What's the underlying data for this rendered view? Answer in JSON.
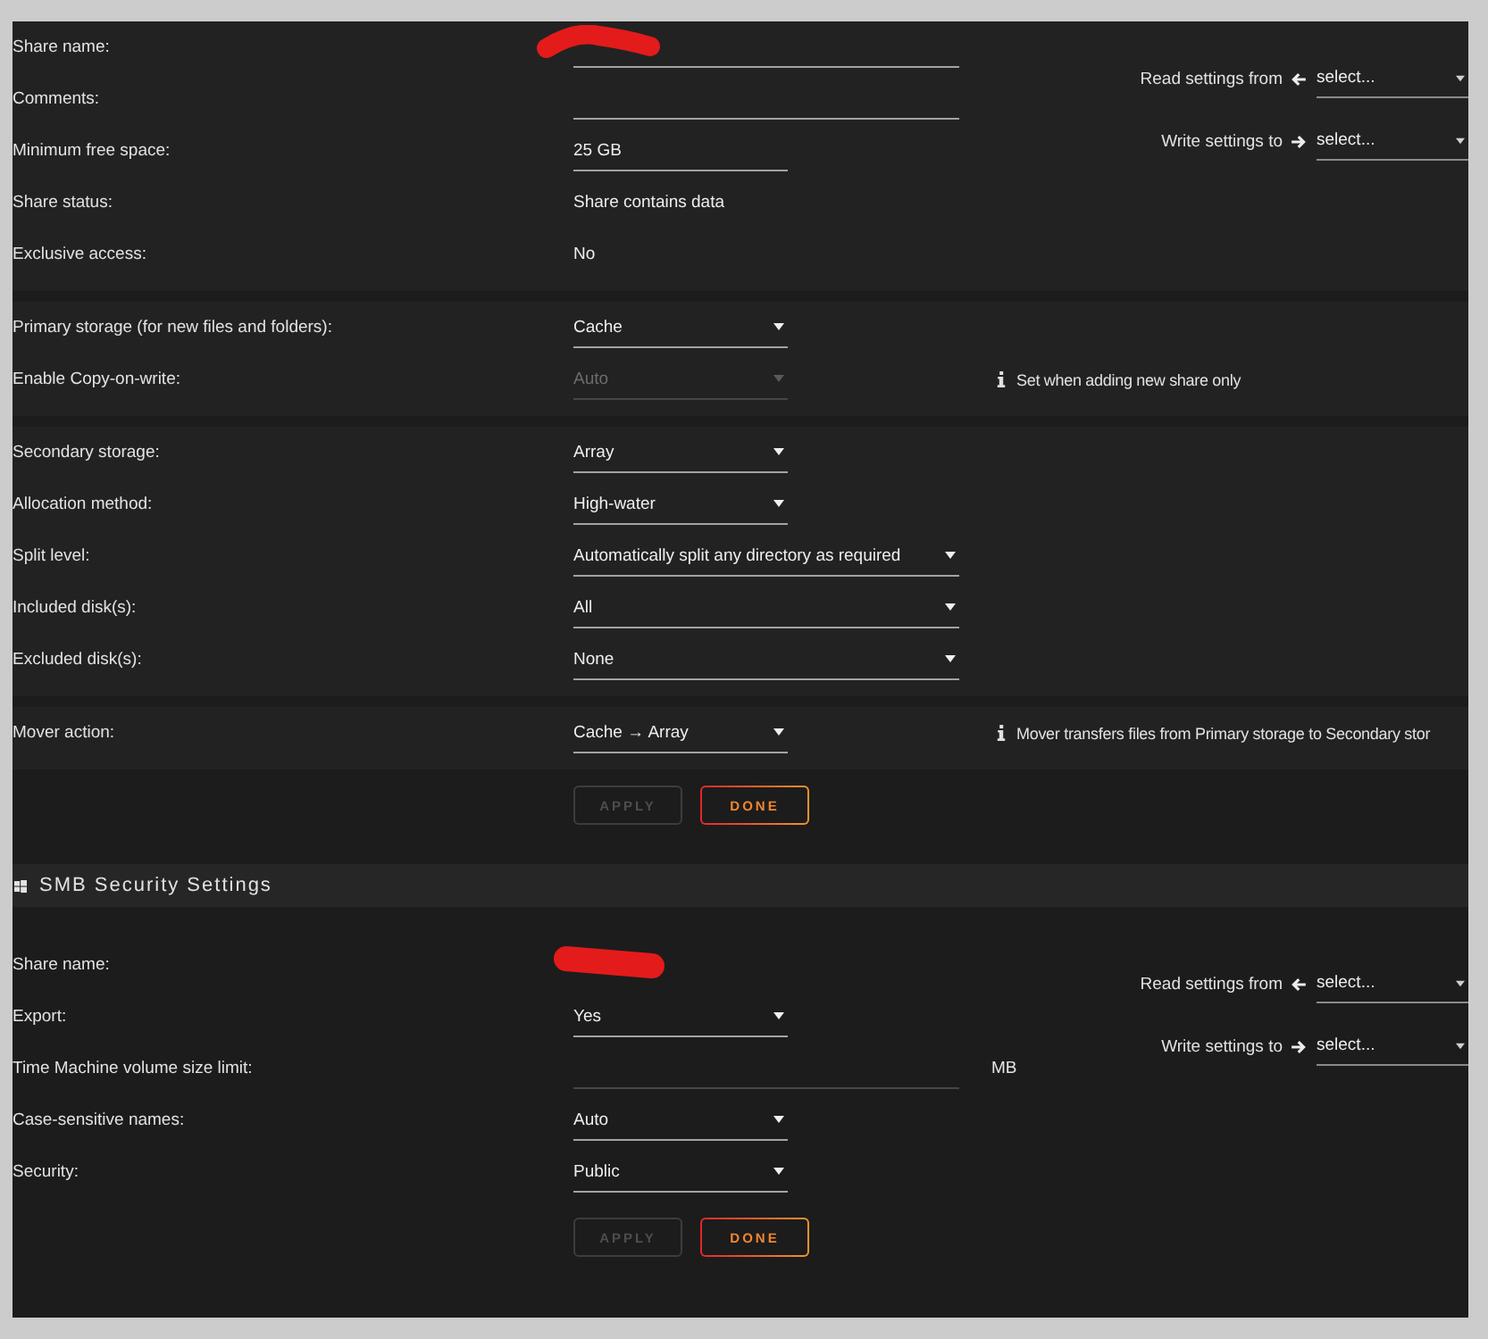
{
  "share_settings": {
    "groups": [
      {
        "rows": [
          {
            "label": "Share name:",
            "kind": "field",
            "disabled": false,
            "redacted": true
          },
          {
            "label": "Comments:",
            "kind": "field",
            "disabled": false,
            "redacted": false
          },
          {
            "label": "Minimum free space:",
            "kind": "shortfield",
            "value": "25 GB",
            "disabled": false,
            "redacted": false
          },
          {
            "label": "Share status:",
            "kind": "text",
            "value": "Share contains data",
            "redacted": false
          },
          {
            "label": "Exclusive access:",
            "kind": "text",
            "value": "No",
            "redacted": false
          }
        ]
      },
      {
        "rows": [
          {
            "label": "Primary storage (for new files and folders):",
            "kind": "select",
            "value": "Cache",
            "disabled": false,
            "redacted": false
          },
          {
            "label": "Enable Copy-on-write:",
            "kind": "select",
            "value": "Auto",
            "disabled": true,
            "redacted": false,
            "note": "Set when adding new share only"
          }
        ]
      },
      {
        "rows": [
          {
            "label": "Secondary storage:",
            "kind": "select",
            "value": "Array",
            "disabled": false,
            "redacted": false
          },
          {
            "label": "Allocation method:",
            "kind": "select",
            "value": "High-water",
            "disabled": false,
            "redacted": false
          },
          {
            "label": "Split level:",
            "kind": "wideselect",
            "value": "Automatically split any directory as required",
            "disabled": false,
            "redacted": false
          },
          {
            "label": "Included disk(s):",
            "kind": "wideselect",
            "value": "All",
            "disabled": false,
            "redacted": false
          },
          {
            "label": "Excluded disk(s):",
            "kind": "wideselect",
            "value": "None",
            "disabled": false,
            "redacted": false
          }
        ]
      },
      {
        "rows": [
          {
            "label": "Mover action:",
            "kind": "select",
            "value": "Cache → Array",
            "disabled": false,
            "redacted": false,
            "note": "Mover transfers files from Primary storage to Secondary stor"
          }
        ]
      }
    ],
    "copy_settings": [
      {
        "label": "Read settings from",
        "kind": "read",
        "value": "select..."
      },
      {
        "label": "Write settings to",
        "kind": "write",
        "value": "select..."
      }
    ],
    "buttons": [
      {
        "label": "APPLY",
        "disabled": true
      },
      {
        "label": "DONE",
        "disabled": false
      }
    ]
  },
  "smb_security": {
    "title": "SMB Security Settings",
    "rows": [
      {
        "label": "Share name:",
        "kind": "text",
        "redacted": true
      },
      {
        "label": "Export:",
        "kind": "select",
        "value": "Yes",
        "disabled": false,
        "redacted": false
      },
      {
        "label": "Time Machine volume size limit:",
        "kind": "field",
        "unit": "MB",
        "disabled": true,
        "redacted": false
      },
      {
        "label": "Case-sensitive names:",
        "kind": "select",
        "value": "Auto",
        "disabled": false,
        "redacted": false
      },
      {
        "label": "Security:",
        "kind": "select",
        "value": "Public",
        "disabled": false,
        "redacted": false
      }
    ],
    "copy_settings": [
      {
        "label": "Read settings from",
        "kind": "read",
        "value": "select..."
      },
      {
        "label": "Write settings to",
        "kind": "write",
        "value": "select..."
      }
    ],
    "buttons": [
      {
        "label": "APPLY",
        "disabled": true
      },
      {
        "label": "DONE",
        "disabled": false
      }
    ]
  }
}
